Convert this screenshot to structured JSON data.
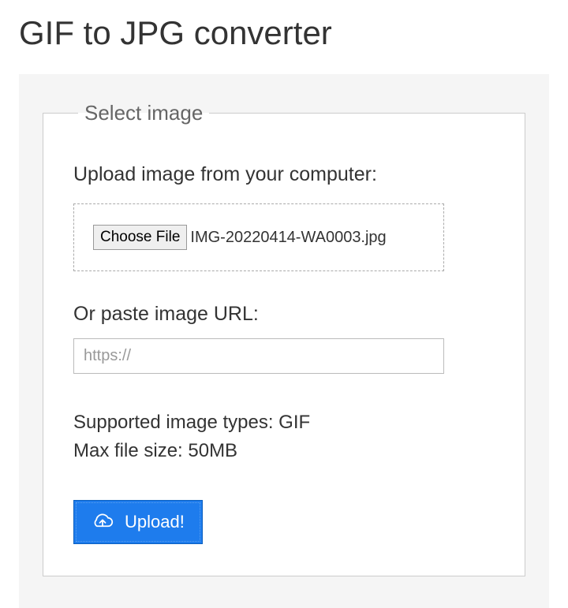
{
  "page": {
    "title": "GIF to JPG converter"
  },
  "form": {
    "legend": "Select image",
    "upload_label": "Upload image from your computer:",
    "choose_file_label": "Choose File",
    "selected_file": "IMG-20220414-WA0003.jpg",
    "or_label": "Or paste image URL:",
    "url_placeholder": "https://",
    "supported_types": "Supported image types: GIF",
    "max_size": "Max file size: 50MB",
    "upload_button": "Upload!"
  }
}
